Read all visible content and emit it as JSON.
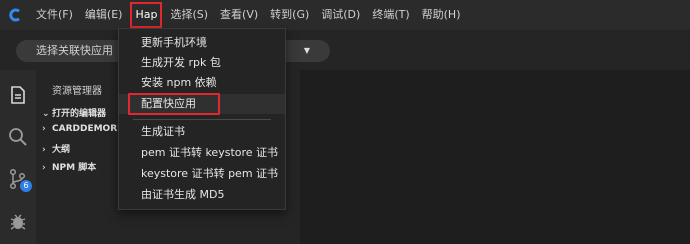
{
  "menubar": {
    "logo_icon": "app-logo-icon",
    "items": [
      {
        "label": "文件(F)"
      },
      {
        "label": "编辑(E)"
      },
      {
        "label": "Hap"
      },
      {
        "label": "选择(S)"
      },
      {
        "label": "查看(V)"
      },
      {
        "label": "转到(G)"
      },
      {
        "label": "调试(D)"
      },
      {
        "label": "终端(T)"
      },
      {
        "label": "帮助(H)"
      }
    ],
    "active_label": "Hap",
    "highlight_color": "#e0282e"
  },
  "toolbar": {
    "run_select_label": "选择关联快应用"
  },
  "activitybar": {
    "icons": [
      "explorer-icon",
      "search-icon",
      "source-control-icon",
      "debug-icon"
    ],
    "badge_count": "6"
  },
  "sidebar": {
    "title": "资源管理器",
    "sections": [
      {
        "label": "打开的编辑器",
        "icon": "chevron-down-icon"
      },
      {
        "label": "CARDDEMORPI",
        "icon": "chevron-right-icon"
      },
      {
        "label": "大纲",
        "icon": "chevron-right-icon"
      },
      {
        "label": "NPM 脚本",
        "icon": "chevron-right-icon"
      }
    ]
  },
  "hap_menu": {
    "items": [
      {
        "label": "更新手机环境"
      },
      {
        "label": "生成开发 rpk 包"
      },
      {
        "label": "安装 npm 依赖"
      },
      {
        "label": "配置快应用"
      },
      {
        "label": "生成证书"
      },
      {
        "label": "pem 证书转 keystore 证书"
      },
      {
        "label": "keystore 证书转 pem 证书"
      },
      {
        "label": "由证书生成 MD5"
      }
    ],
    "highlighted_item": "配置快应用"
  }
}
